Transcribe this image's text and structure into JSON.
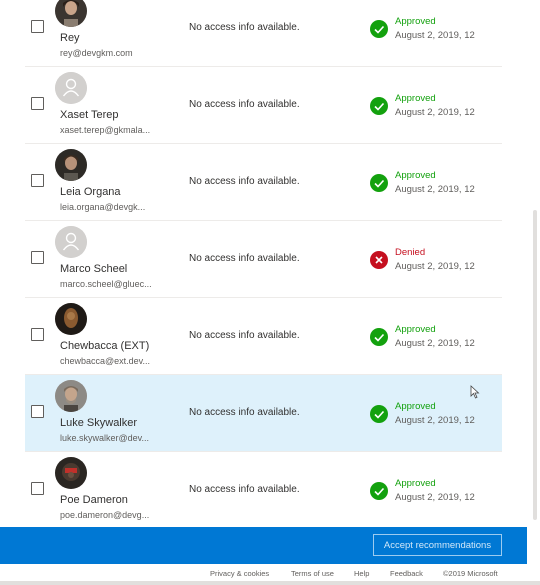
{
  "rows": [
    {
      "name": "Rey",
      "email": "rey@devgkm.com",
      "access": "No access info available.",
      "status": "Approved",
      "status_kind": "ok",
      "date": "August 2, 2019, 12",
      "avatar": "photo-dark",
      "avatar_icon": "user-photo-icon"
    },
    {
      "name": "Xaset Terep",
      "email": "xaset.terep@gkmala...",
      "access": "No access info available.",
      "status": "Approved",
      "status_kind": "ok",
      "date": "August 2, 2019, 12",
      "avatar": "placeholder",
      "avatar_icon": "person-placeholder-icon"
    },
    {
      "name": "Leia Organa",
      "email": "leia.organa@devgk...",
      "access": "No access info available.",
      "status": "Approved",
      "status_kind": "ok",
      "date": "August 2, 2019, 12",
      "avatar": "photo-dark",
      "avatar_icon": "user-photo-icon"
    },
    {
      "name": "Marco Scheel",
      "email": "marco.scheel@gluec...",
      "access": "No access info available.",
      "status": "Denied",
      "status_kind": "bad",
      "date": "August 2, 2019, 12",
      "avatar": "placeholder",
      "avatar_icon": "person-placeholder-icon"
    },
    {
      "name": "Chewbacca (EXT)",
      "email": "chewbacca@ext.dev...",
      "access": "No access info available.",
      "status": "Approved",
      "status_kind": "ok",
      "date": "August 2, 2019, 12",
      "avatar": "photo-brown",
      "avatar_icon": "user-photo-icon"
    },
    {
      "name": "Luke Skywalker",
      "email": "luke.skywalker@dev...",
      "access": "No access info available.",
      "status": "Approved",
      "status_kind": "ok",
      "date": "August 2, 2019, 12",
      "avatar": "photo-grey",
      "avatar_icon": "user-photo-icon",
      "selected": true
    },
    {
      "name": "Poe Dameron",
      "email": "poe.dameron@devg...",
      "access": "No access info available.",
      "status": "Approved",
      "status_kind": "ok",
      "date": "August 2, 2019, 12",
      "avatar": "photo-dark",
      "avatar_icon": "user-photo-icon"
    }
  ],
  "action_bar": {
    "accept_label": "Accept recommendations",
    "color": "#0078d4"
  },
  "footer": {
    "privacy": "Privacy & cookies",
    "terms": "Terms of use",
    "help": "Help",
    "feedback": "Feedback",
    "copyright": "©2019 Microsoft"
  },
  "colors": {
    "approved": "#13a10e",
    "denied": "#c50f1f",
    "selected_row": "#def1fb"
  }
}
